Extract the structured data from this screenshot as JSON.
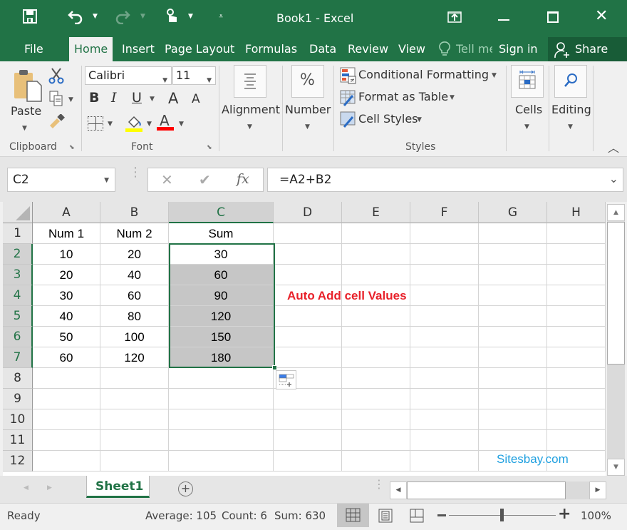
{
  "window": {
    "title": "Book1 - Excel"
  },
  "qat": {
    "save": "save-icon",
    "undo": "undo-icon",
    "redo": "redo-icon",
    "touch": "touch-mode-icon",
    "customize": "customize-qat-icon"
  },
  "tabs": [
    {
      "label": "File"
    },
    {
      "label": "Home"
    },
    {
      "label": "Insert"
    },
    {
      "label": "Page Layout"
    },
    {
      "label": "Formulas"
    },
    {
      "label": "Data"
    },
    {
      "label": "Review"
    },
    {
      "label": "View"
    }
  ],
  "tell_me": "Tell me",
  "sign_in": "Sign in",
  "share": "Share",
  "ribbon": {
    "clipboard": {
      "paste": "Paste",
      "group": "Clipboard"
    },
    "font": {
      "name": "Calibri",
      "size": "11",
      "bold": "B",
      "italic": "I",
      "underline": "U",
      "grow": "A",
      "shrink": "A",
      "fontcolor": "A",
      "group": "Font",
      "fill_color": "#ffff00",
      "font_color": "#ff0000"
    },
    "alignment": {
      "label": "Alignment"
    },
    "number": {
      "label": "Number",
      "icon_text": "%"
    },
    "styles": {
      "conditional": "Conditional Formatting",
      "format_table": "Format as Table",
      "cell_styles": "Cell Styles",
      "group": "Styles"
    },
    "cells": {
      "label": "Cells"
    },
    "editing": {
      "label": "Editing"
    }
  },
  "formula_bar": {
    "name_box": "C2",
    "fx": "fx",
    "formula": "=A2+B2"
  },
  "columns": [
    "A",
    "B",
    "C",
    "D",
    "E",
    "F",
    "G",
    "H"
  ],
  "rows": [
    "1",
    "2",
    "3",
    "4",
    "5",
    "6",
    "7",
    "8",
    "9",
    "10",
    "11",
    "12"
  ],
  "cells": {
    "r1": [
      "Num 1",
      "Num 2",
      "Sum"
    ],
    "r2": [
      "10",
      "20",
      "30"
    ],
    "r3": [
      "20",
      "40",
      "60"
    ],
    "r4": [
      "30",
      "60",
      "90"
    ],
    "r5": [
      "40",
      "80",
      "120"
    ],
    "r6": [
      "50",
      "100",
      "150"
    ],
    "r7": [
      "60",
      "120",
      "180"
    ]
  },
  "annotation": {
    "text": "Auto Add cell Values",
    "color": "#e8212a"
  },
  "watermark": {
    "text": "Sitesbay.com",
    "color": "#1fa0e0"
  },
  "sheets": [
    {
      "label": "Sheet1"
    }
  ],
  "status": {
    "ready": "Ready",
    "average": "Average: 105",
    "count": "Count: 6",
    "sum": "Sum: 630",
    "zoom": "100%"
  }
}
